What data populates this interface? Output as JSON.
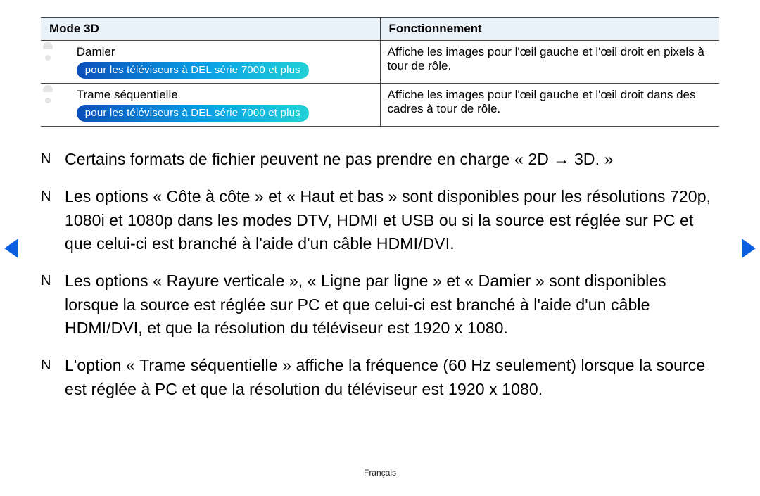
{
  "table": {
    "headers": {
      "mode": "Mode 3D",
      "func": "Fonctionnement"
    },
    "rows": [
      {
        "mode_label": "Damier",
        "badge": "pour les téléviseurs à DEL série 7000 et plus",
        "func": "Affiche les images pour l'œil gauche et l'œil droit en pixels à tour de rôle."
      },
      {
        "mode_label": "Trame séquentielle",
        "badge": "pour les téléviseurs à DEL série 7000 et plus",
        "func": "Affiche les images pour l'œil gauche et l'œil droit dans des cadres à tour de rôle."
      }
    ]
  },
  "notes": [
    "Certains formats de fichier peuvent ne pas prendre en charge « 2D → 3D. »",
    "Les options « Côte à côte » et « Haut et bas » sont disponibles pour les résolutions 720p, 1080i et 1080p dans les modes DTV, HDMI et USB ou si la source est réglée sur PC et que celui-ci est branché à l'aide d'un câble HDMI/DVI.",
    "Les options « Rayure verticale », « Ligne par ligne » et « Damier » sont disponibles lorsque la source est réglée sur PC et que celui-ci est branché à l'aide d'un câble HDMI/DVI, et que la résolution du téléviseur est 1920 x 1080.",
    "L'option « Trame séquentielle » affiche la fréquence (60 Hz seulement) lorsque la source est réglée à PC et que la résolution du téléviseur est 1920 x 1080."
  ],
  "note_marker": "N",
  "footer": "Français"
}
